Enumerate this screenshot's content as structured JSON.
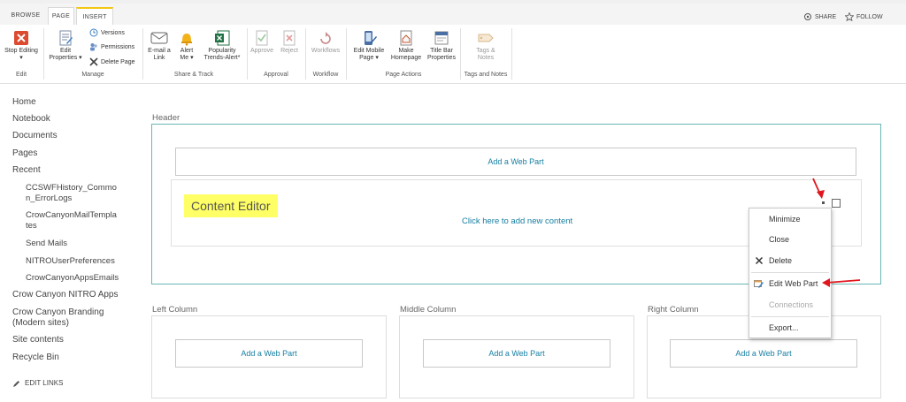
{
  "tabs": [
    {
      "label": "BROWSE"
    },
    {
      "label": "PAGE"
    },
    {
      "label": "INSERT"
    }
  ],
  "top_right": {
    "share": "SHARE",
    "follow": "FOLLOW"
  },
  "ribbon": {
    "edit": {
      "stop_editing": "Stop Editing",
      "group": "Edit"
    },
    "manage": {
      "edit_properties_1": "Edit",
      "edit_properties_2": "Properties",
      "versions": "Versions",
      "permissions": "Permissions",
      "delete_page": "Delete Page",
      "group": "Manage"
    },
    "share_track": {
      "email_1": "E-mail a",
      "email_2": "Link",
      "alert_1": "Alert",
      "alert_2": "Me",
      "popularity_1": "Popularity",
      "popularity_2": "Trends-Alert*",
      "group": "Share & Track"
    },
    "approval": {
      "approve": "Approve",
      "reject": "Reject",
      "group": "Approval"
    },
    "workflow": {
      "workflows": "Workflows",
      "group": "Workflow"
    },
    "page_actions": {
      "edit_mobile_1": "Edit Mobile",
      "edit_mobile_2": "Page",
      "make_home_1": "Make",
      "make_home_2": "Homepage",
      "title_bar_1": "Title Bar",
      "title_bar_2": "Properties",
      "group": "Page Actions"
    },
    "tags": {
      "tags_1": "Tags &",
      "tags_2": "Notes",
      "group": "Tags and Notes"
    }
  },
  "nav": {
    "items": [
      "Home",
      "Notebook",
      "Documents",
      "Pages",
      "Recent"
    ],
    "recent": [
      "CCSWFHistory_Commo",
      "n_ErrorLogs",
      "CrowCanyonMailTempla",
      "tes",
      "Send Mails",
      "NITROUserPreferences",
      "CrowCanyonAppsEmails"
    ],
    "more": [
      "Crow Canyon NITRO Apps",
      "Crow Canyon Branding",
      "(Modern sites)",
      "Site contents",
      "Recycle Bin"
    ],
    "edit_links": "EDIT LINKS"
  },
  "zones": {
    "header": "Header",
    "left": "Left Column",
    "middle": "Middle Column",
    "right": "Right Column",
    "add_web_part": "Add a Web Part"
  },
  "content_editor": {
    "title": "Content Editor",
    "click_text": "Click here to add new content"
  },
  "context_menu": {
    "minimize": "Minimize",
    "close": "Close",
    "delete": "Delete",
    "edit_web_part": "Edit Web Part",
    "connections": "Connections",
    "export": "Export..."
  },
  "colors": {
    "accent": "#157ea2",
    "highlight": "#ffff66",
    "zone_border": "#68b7b4",
    "arrow": "#e0161e"
  }
}
